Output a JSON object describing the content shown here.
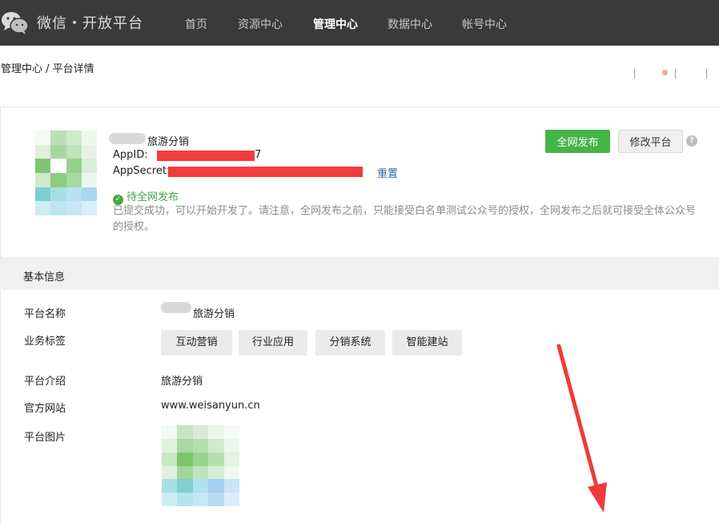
{
  "header": {
    "logo_text": "微信・开放平台",
    "nav": [
      {
        "label": "首页",
        "active": false
      },
      {
        "label": "资源中心",
        "active": false
      },
      {
        "label": "管理中心",
        "active": true
      },
      {
        "label": "数据中心",
        "active": false
      },
      {
        "label": "帐号中心",
        "active": false
      }
    ]
  },
  "breadcrumb": "管理中心 / 平台详情",
  "app": {
    "name_suffix": "旅游分销",
    "appid_label": "AppID:",
    "appid_tail": "7",
    "appsecret_label": "AppSecret:",
    "appsecret_tail": "",
    "reset_label": "重置",
    "status_text": "待全网发布",
    "description": "已提交成功，可以开始开发了。请注意，全网发布之前，只能接受白名单测试公众号的授权，全网发布之后就可接受全体公众号的授权。",
    "publish_button": "全网发布",
    "edit_button": "修改平台",
    "help_icon": "?"
  },
  "basic_info": {
    "section_title": "基本信息",
    "name_label": "平台名称",
    "name_value": "旅游分销",
    "tags_label": "业务标签",
    "tags": [
      "互动营销",
      "行业应用",
      "分销系统",
      "智能建站"
    ],
    "intro_label": "平台介绍",
    "intro_value": "旅游分销",
    "website_label": "官方网站",
    "website_value": "www.weisanyun.cn",
    "image_label": "平台图片"
  },
  "colors": {
    "nav_bg": "#3a3a3a",
    "primary_green": "#44b549",
    "status_green": "#44a843",
    "link_blue": "#2d6aae",
    "redaction_red": "#f23c3c",
    "annotation_arrow": "#f03a3a"
  }
}
